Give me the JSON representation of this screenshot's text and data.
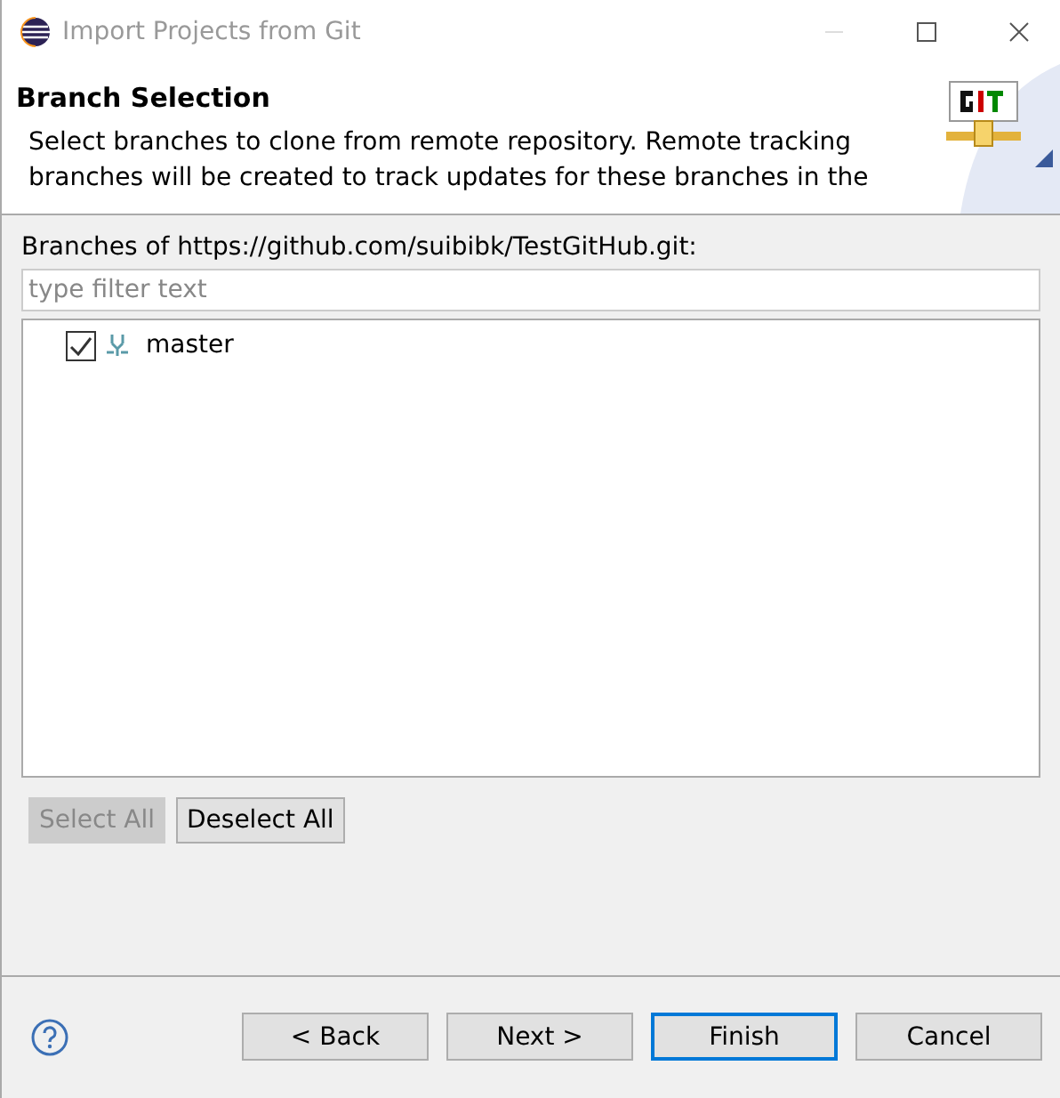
{
  "window": {
    "title": "Import Projects from Git"
  },
  "header": {
    "title": "Branch Selection",
    "description": "Select branches to clone from remote repository. Remote tracking branches will be created to track updates for these branches in the"
  },
  "branches_label": "Branches of https://github.com/suibibk/TestGitHub.git:",
  "filter": {
    "placeholder": "type filter text"
  },
  "branches": [
    {
      "name": "master",
      "checked": true
    }
  ],
  "selection_buttons": [
    {
      "label": "Select All",
      "disabled": true
    },
    {
      "label": "Deselect All",
      "disabled": false
    }
  ],
  "buttons": [
    {
      "label": "< Back",
      "default": false
    },
    {
      "label": "Next >",
      "default": false
    },
    {
      "label": "Finish",
      "default": true
    },
    {
      "label": "Cancel",
      "default": false
    }
  ]
}
